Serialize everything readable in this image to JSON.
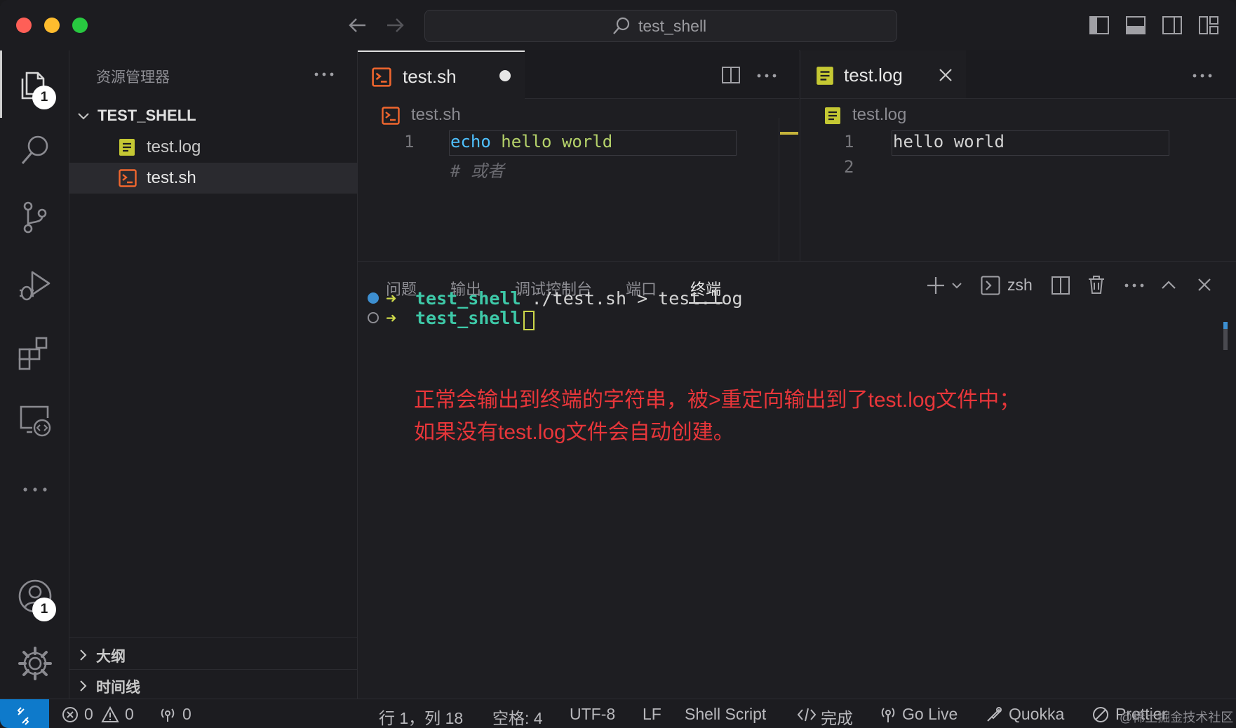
{
  "titlebar": {
    "search_text": "test_shell"
  },
  "activity": {
    "explorer_badge": "1",
    "accounts_badge": "1"
  },
  "sidebar": {
    "title": "资源管理器",
    "folder": "TEST_SHELL",
    "files": [
      {
        "name": "test.log"
      },
      {
        "name": "test.sh"
      }
    ],
    "outline": "大纲",
    "timeline": "时间线"
  },
  "editor_left": {
    "tab": "test.sh",
    "breadcrumb": "test.sh",
    "lines": [
      {
        "num": "1",
        "kw": "echo",
        "rest": " hello world"
      },
      {
        "num": "",
        "comment": "# 或者"
      }
    ]
  },
  "editor_right": {
    "tab": "test.log",
    "breadcrumb": "test.log",
    "lines": [
      {
        "num": "1",
        "text": "hello world"
      },
      {
        "num": "2",
        "text": ""
      }
    ]
  },
  "panel": {
    "tabs": [
      "问题",
      "输出",
      "调试控制台",
      "端口",
      "终端"
    ],
    "active_tab": "终端",
    "shell_label": "zsh",
    "terminal": [
      {
        "dir": "test_shell",
        "cmd": " ./test.sh > test.log"
      },
      {
        "dir": "test_shell",
        "cmd": ""
      }
    ],
    "annotation": [
      "正常会输出到终端的字符串，被>重定向输出到了test.log文件中；",
      "如果没有test.log文件会自动创建。"
    ]
  },
  "statusbar": {
    "errors": "0",
    "warnings": "0",
    "ports": "0",
    "cursor": "行 1，列 18",
    "spaces": "空格: 4",
    "encoding": "UTF-8",
    "eol": "LF",
    "language": "Shell Script",
    "format": "完成",
    "golive": "Go Live",
    "quokka": "Quokka",
    "prettier": "Prettier",
    "watermark": "@稀土掘金技术社区"
  },
  "colors": {
    "accent": "#0e7acb",
    "annotation": "#e8363a",
    "terminal_dir": "#3ec9a8",
    "keyword": "#4fc1ff",
    "string": "#b5d26a",
    "shell_icon": "#f0662e",
    "log_icon": "#c5c833"
  }
}
